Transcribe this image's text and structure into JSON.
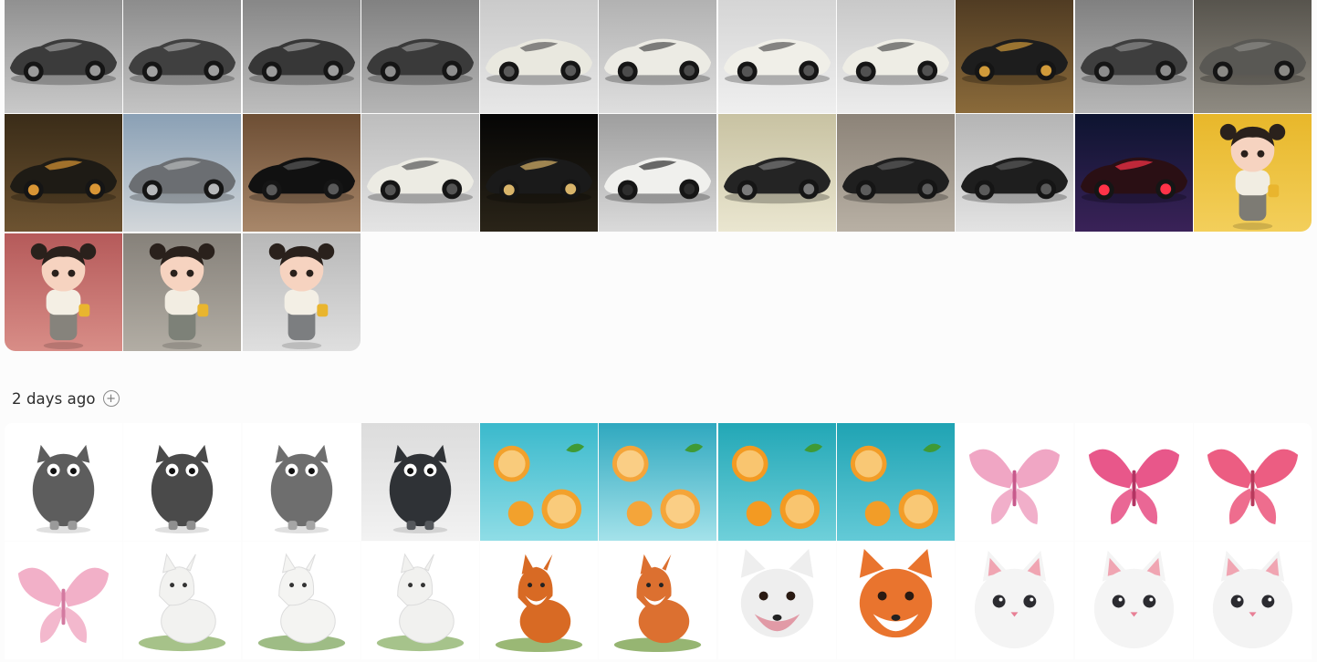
{
  "groups": [
    {
      "id": "top",
      "label": "",
      "thumbnails": [
        {
          "kind": "car",
          "bg": "#8e8e8e",
          "bg2": "#c9c9c9",
          "body": "#3b3b3b",
          "accent": "#9a9a9a"
        },
        {
          "kind": "car",
          "bg": "#8a8a8a",
          "bg2": "#c4c4c4",
          "body": "#404040",
          "accent": "#a0a0a0"
        },
        {
          "kind": "car",
          "bg": "#858585",
          "bg2": "#bdbdbd",
          "body": "#373737",
          "accent": "#9c9c9c"
        },
        {
          "kind": "car",
          "bg": "#7f7f7f",
          "bg2": "#b5b5b5",
          "body": "#3a3a3a",
          "accent": "#8e8e8e"
        },
        {
          "kind": "car",
          "bg": "#c9c9c9",
          "bg2": "#e7e7e7",
          "body": "#e9e8df",
          "accent": "#5a5a5a"
        },
        {
          "kind": "car",
          "bg": "#b0b0b0",
          "bg2": "#dedede",
          "body": "#ecebe4",
          "accent": "#4b4b4b"
        },
        {
          "kind": "car",
          "bg": "#d4d4d4",
          "bg2": "#efefef",
          "body": "#f0efe8",
          "accent": "#555555"
        },
        {
          "kind": "car",
          "bg": "#c7c7c7",
          "bg2": "#ececec",
          "body": "#eeede5",
          "accent": "#515151"
        },
        {
          "kind": "car",
          "bg": "#4e3a22",
          "bg2": "#8a6a3a",
          "body": "#1d1d1d",
          "accent": "#d09a3a"
        },
        {
          "kind": "car",
          "bg": "#7e7e7e",
          "bg2": "#b7b7b7",
          "body": "#3e3e3e",
          "accent": "#8c8c8c"
        },
        {
          "kind": "car",
          "bg": "#55524b",
          "bg2": "#8f8b82",
          "body": "#595854",
          "accent": "#8b8a86"
        },
        {
          "kind": "car",
          "bg": "#3a2c18",
          "bg2": "#6d5331",
          "body": "#1e1b15",
          "accent": "#d89535"
        },
        {
          "kind": "car",
          "bg": "#8aa0b5",
          "bg2": "#d3d7da",
          "body": "#6b6e72",
          "accent": "#b7b9bb"
        },
        {
          "kind": "car",
          "bg": "#6d4e34",
          "bg2": "#a8876a",
          "body": "#111111",
          "accent": "#5a5a5a"
        },
        {
          "kind": "car",
          "bg": "#bdbdbd",
          "bg2": "#e4e4e4",
          "body": "#ecebe3",
          "accent": "#555555"
        },
        {
          "kind": "car",
          "bg": "#050505",
          "bg2": "#2a2418",
          "body": "#1a1a1a",
          "accent": "#d8b46a"
        },
        {
          "kind": "car",
          "bg": "#9e9e9e",
          "bg2": "#dadada",
          "body": "#f0f0ed",
          "accent": "#2d2d2d"
        },
        {
          "kind": "car",
          "bg": "#c8c2a2",
          "bg2": "#eae6d0",
          "body": "#242424",
          "accent": "#7a7a7a"
        },
        {
          "kind": "car",
          "bg": "#8c8378",
          "bg2": "#b8b0a4",
          "body": "#1f1f1f",
          "accent": "#5c5c5c"
        },
        {
          "kind": "car",
          "bg": "#b4b4b4",
          "bg2": "#e3e3e3",
          "body": "#1e1e1e",
          "accent": "#5a5a5a"
        },
        {
          "kind": "car",
          "bg": "#0d1430",
          "bg2": "#3a2258",
          "body": "#2a0f14",
          "accent": "#ff3348"
        },
        {
          "kind": "girl",
          "bg": "#e8b72a",
          "bg2": "#f3cf5b",
          "body": "#f1ede2",
          "accent": "#7d7b74"
        },
        {
          "kind": "girl",
          "bg": "#b55a5a",
          "bg2": "#d88d87",
          "body": "#f4efe4",
          "accent": "#86837c"
        },
        {
          "kind": "girl",
          "bg": "#86817a",
          "bg2": "#b2ada4",
          "body": "#f2ede2",
          "accent": "#7d8178"
        },
        {
          "kind": "girl",
          "bg": "#b8b8b8",
          "bg2": "#dfdfdf",
          "body": "#f3efe5",
          "accent": "#7c7e80"
        }
      ]
    },
    {
      "id": "two-days",
      "label": "2 days ago",
      "thumbnails": [
        {
          "kind": "cat",
          "bg": "#ffffff",
          "bg2": "#ffffff",
          "body": "#5d5d5d",
          "accent": "#9a9a9a"
        },
        {
          "kind": "cat",
          "bg": "#ffffff",
          "bg2": "#ffffff",
          "body": "#4a4a4a",
          "accent": "#8f8f8f"
        },
        {
          "kind": "cat",
          "bg": "#ffffff",
          "bg2": "#ffffff",
          "body": "#6e6e6e",
          "accent": "#a5a5a5"
        },
        {
          "kind": "cat",
          "bg": "#dcdcdc",
          "bg2": "#f2f2f2",
          "body": "#2f3236",
          "accent": "#55585c"
        },
        {
          "kind": "orange",
          "bg": "#3ab9cc",
          "bg2": "#8fdde6",
          "body": "#f2a12c",
          "accent": "#fde7b0"
        },
        {
          "kind": "orange",
          "bg": "#2fa8bf",
          "bg2": "#a4e2ea",
          "body": "#f4a53a",
          "accent": "#fde9b8"
        },
        {
          "kind": "orange",
          "bg": "#22a7b6",
          "bg2": "#6fd0da",
          "body": "#f39a22",
          "accent": "#fde2a3"
        },
        {
          "kind": "orange",
          "bg": "#1fa3b3",
          "bg2": "#63cad7",
          "body": "#f29d28",
          "accent": "#fde4a8"
        },
        {
          "kind": "butterfly",
          "bg": "#ffffff",
          "bg2": "#ffffff",
          "body": "#f0a6c4",
          "accent": "#c85a8c"
        },
        {
          "kind": "butterfly",
          "bg": "#ffffff",
          "bg2": "#ffffff",
          "body": "#e8578a",
          "accent": "#b23462"
        },
        {
          "kind": "butterfly",
          "bg": "#ffffff",
          "bg2": "#ffffff",
          "body": "#ec5d82",
          "accent": "#b83a5c"
        },
        {
          "kind": "butterfly",
          "bg": "#ffffff",
          "bg2": "#ffffff",
          "body": "#f2b0c8",
          "accent": "#d37aa0"
        },
        {
          "kind": "whitefox",
          "bg": "#ffffff",
          "bg2": "#ffffff",
          "body": "#f2f2f0",
          "accent": "#6a9a3a"
        },
        {
          "kind": "whitefox",
          "bg": "#ffffff",
          "bg2": "#ffffff",
          "body": "#f4f4f2",
          "accent": "#5e8f34"
        },
        {
          "kind": "whitefox",
          "bg": "#ffffff",
          "bg2": "#ffffff",
          "body": "#f1f1ef",
          "accent": "#6b9b3d"
        },
        {
          "kind": "fox",
          "bg": "#ffffff",
          "bg2": "#ffffff",
          "body": "#d86a24",
          "accent": "#6f9a3a"
        },
        {
          "kind": "fox",
          "bg": "#ffffff",
          "bg2": "#ffffff",
          "body": "#dc7030",
          "accent": "#6a9636"
        },
        {
          "kind": "foxface",
          "bg": "#ffffff",
          "bg2": "#ffffff",
          "body": "#eeeeee",
          "accent": "#e19aa6"
        },
        {
          "kind": "foxface",
          "bg": "#ffffff",
          "bg2": "#ffffff",
          "body": "#e9742e",
          "accent": "#ffffff"
        },
        {
          "kind": "kitten",
          "bg": "#ffffff",
          "bg2": "#ffffff",
          "body": "#f4f4f4",
          "accent": "#f0a5b2"
        },
        {
          "kind": "kitten",
          "bg": "#ffffff",
          "bg2": "#ffffff",
          "body": "#f4f4f4",
          "accent": "#f0a5b2"
        },
        {
          "kind": "kitten",
          "bg": "#ffffff",
          "bg2": "#ffffff",
          "body": "#f3f3f3",
          "accent": "#f0a5b2"
        }
      ]
    }
  ],
  "icons": {
    "add": "plus-circle-icon"
  }
}
